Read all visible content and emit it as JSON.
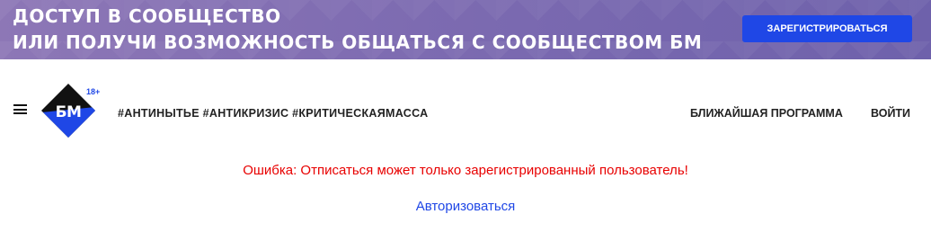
{
  "banner": {
    "line1": "ДОСТУП В СООБЩЕСТВО",
    "line2": "ИЛИ ПОЛУЧИ ВОЗМОЖНОСТЬ ОБЩАТЬСЯ С СООБЩЕСТВОМ БМ",
    "register_label": "ЗАРЕГИСТРИРОВАТЬСЯ"
  },
  "header": {
    "logo_text": "БМ",
    "age_badge": "18+",
    "hashtags": "#АНТИНЫТЬЕ #АНТИКРИЗИС #КРИТИЧЕСКАЯМАССА",
    "nav": {
      "program_label": "БЛИЖАЙШАЯ ПРОГРАММА",
      "login_label": "ВОЙТИ"
    }
  },
  "content": {
    "error_message": "Ошибка: Отписаться может только зарегистрированный пользователь!",
    "auth_link": "Авторизоваться"
  },
  "colors": {
    "banner_bg": "#7d6bb1",
    "accent_blue": "#1f47e6",
    "error_red": "#e80000",
    "logo_dark": "#111111"
  },
  "icons": {
    "menu": "hamburger-menu-icon",
    "logo": "diamond-logo"
  }
}
